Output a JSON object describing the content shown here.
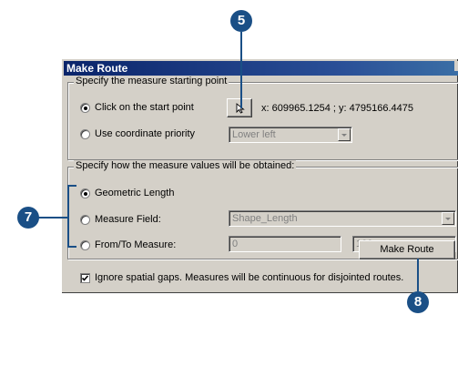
{
  "dialog": {
    "title": "Make Route"
  },
  "start_group": {
    "label": "Specify the measure starting point",
    "click_option": "Click on the start point",
    "coord_option": "Use coordinate priority",
    "coordinates": "x: 609965.1254 ; y: 4795166.4475",
    "priority_select": "Lower left"
  },
  "measure_group": {
    "label": "Specify how the measure values will be obtained:",
    "geometric_option": "Geometric Length",
    "field_option": "Measure Field:",
    "field_select": "Shape_Length",
    "fromto_option": "From/To Measure:",
    "from_value": "0",
    "to_value": "100"
  },
  "ignore_gaps": {
    "label": "Ignore spatial gaps. Measures will be continuous for disjointed routes.",
    "checked": true
  },
  "make_route_button": "Make Route",
  "callouts": {
    "five": "5",
    "seven": "7",
    "eight": "8"
  }
}
